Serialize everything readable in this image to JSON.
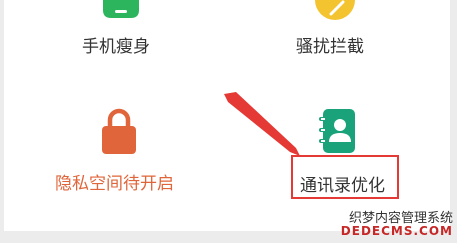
{
  "tiles": [
    {
      "label": "手机瘦身",
      "icon": "phone-slim-icon",
      "color": "#2db55d"
    },
    {
      "label": "骚扰拦截",
      "icon": "block-icon",
      "color": "#f4c430"
    },
    {
      "label": "隐私空间待开启",
      "icon": "lock-icon",
      "color": "#e0653a"
    },
    {
      "label": "通讯录优化",
      "icon": "contacts-icon",
      "color": "#1aa37a"
    }
  ],
  "highlight_color": "#e53935",
  "watermark": {
    "line1": "织梦内容管理系统",
    "line2": "DEDECMS.COM"
  }
}
